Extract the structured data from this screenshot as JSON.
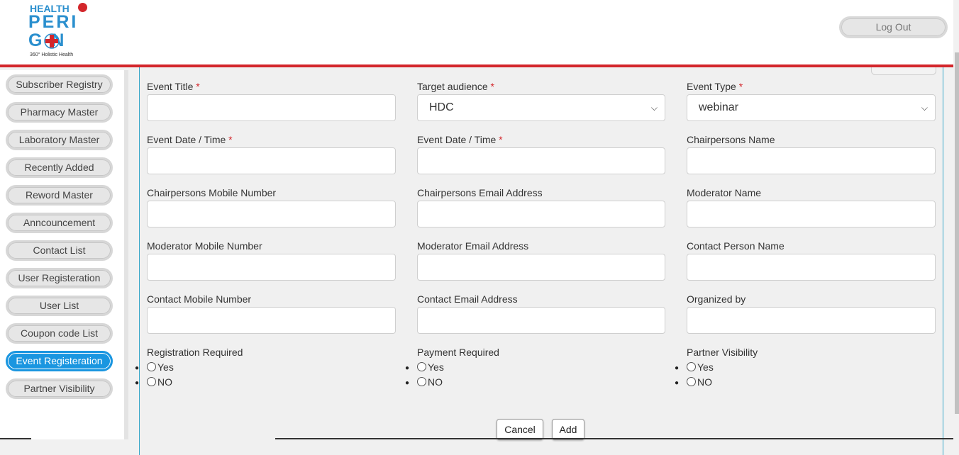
{
  "header": {
    "logo": {
      "line1": "HEALTH",
      "line2": "PERI",
      "line3": "G N",
      "tagline": "360° Holistic Health"
    },
    "logout_label": "Log Out"
  },
  "sidebar": {
    "items": [
      {
        "label": "Subscriber Registry"
      },
      {
        "label": "Pharmacy Master"
      },
      {
        "label": "Laboratory Master"
      },
      {
        "label": "Recently Added"
      },
      {
        "label": "Reword Master"
      },
      {
        "label": "Anncouncement"
      },
      {
        "label": "Contact List"
      },
      {
        "label": "User Registeration"
      },
      {
        "label": "User List"
      },
      {
        "label": "Coupon code List"
      },
      {
        "label": "Event Registeration"
      },
      {
        "label": "Partner Visibility"
      }
    ]
  },
  "form": {
    "event_title": "Event Title",
    "target_audience": "Target audience",
    "target_audience_value": "HDC",
    "event_type": "Event Type",
    "event_type_value": "webinar",
    "event_date_1": "Event Date / Time",
    "event_date_2": "Event Date / Time",
    "chair_name": "Chairpersons Name",
    "chair_mobile": "Chairpersons Mobile Number",
    "chair_email": "Chairpersons Email Address",
    "moderator_name": "Moderator Name",
    "moderator_mobile": "Moderator Mobile Number",
    "moderator_email": "Moderator Email Address",
    "contact_person": "Contact Person Name",
    "contact_mobile": "Contact Mobile Number",
    "contact_email": "Contact Email Address",
    "organized_by": "Organized by",
    "registration_required": "Registration Required",
    "payment_required": "Payment Required",
    "partner_visibility": "Partner Visibility",
    "yes": "Yes",
    "no": "NO",
    "required_mark": "*"
  },
  "actions": {
    "cancel": "Cancel",
    "add": "Add"
  },
  "colors": {
    "brand_blue": "#2a8fce",
    "brand_red": "#d3262b",
    "active": "#1a96e0"
  }
}
